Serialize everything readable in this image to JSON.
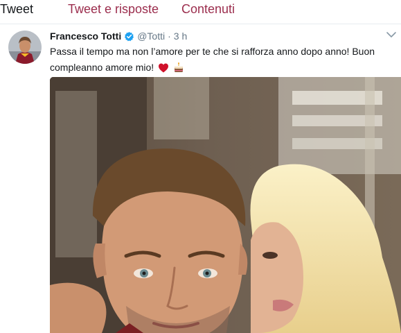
{
  "tabs": [
    {
      "label": "Tweet"
    },
    {
      "label": "Tweet e risposte"
    },
    {
      "label": "Contenuti"
    }
  ],
  "tweet": {
    "fullname": "Francesco Totti",
    "username": "@Totti",
    "separator": "·",
    "time": "3 h",
    "text": "Passa il tempo ma non l’amore per te che si rafforza anno dopo anno! Buon compleanno amore mio!",
    "emojis": [
      "red-heart-emoji",
      "birthday-cake-emoji"
    ],
    "verified_icon": "verified-badge-icon",
    "menu_icon": "chevron-down-icon"
  },
  "colors": {
    "accent_tab": "#9b2d4d",
    "text_primary": "#14171a",
    "text_secondary": "#657786",
    "verified": "#1da1f2",
    "divider": "#e6ecf0"
  }
}
